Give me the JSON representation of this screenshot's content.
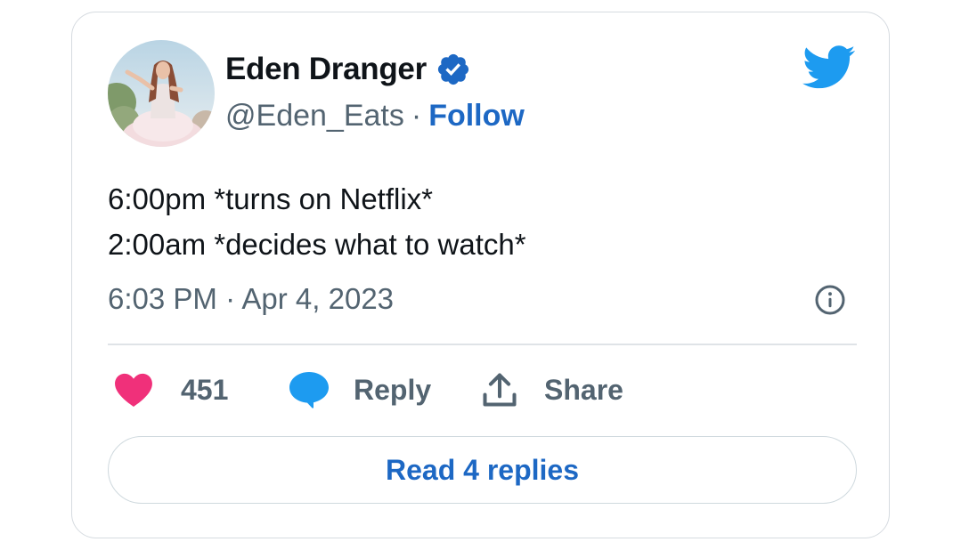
{
  "author": {
    "display_name": "Eden Dranger",
    "handle": "@Eden_Eats",
    "verified": true,
    "avatar_icon": "profile-photo"
  },
  "header": {
    "separator": "·",
    "follow_label": "Follow",
    "brand_icon": "twitter-bird-icon",
    "brand_color": "#1d9bf0"
  },
  "tweet": {
    "lines": [
      "6:00pm *turns on Netflix*",
      "2:00am *decides what to watch*"
    ],
    "timestamp": "6:03 PM · Apr 4, 2023"
  },
  "actions": {
    "like_count": "451",
    "like_color": "#f0307a",
    "reply_label": "Reply",
    "reply_color": "#1d9bf0",
    "share_label": "Share"
  },
  "footer": {
    "read_replies_label": "Read 4 replies"
  },
  "colors": {
    "accent_text": "#1d68c4",
    "secondary_text": "#536471",
    "primary_text": "#0f1419"
  }
}
